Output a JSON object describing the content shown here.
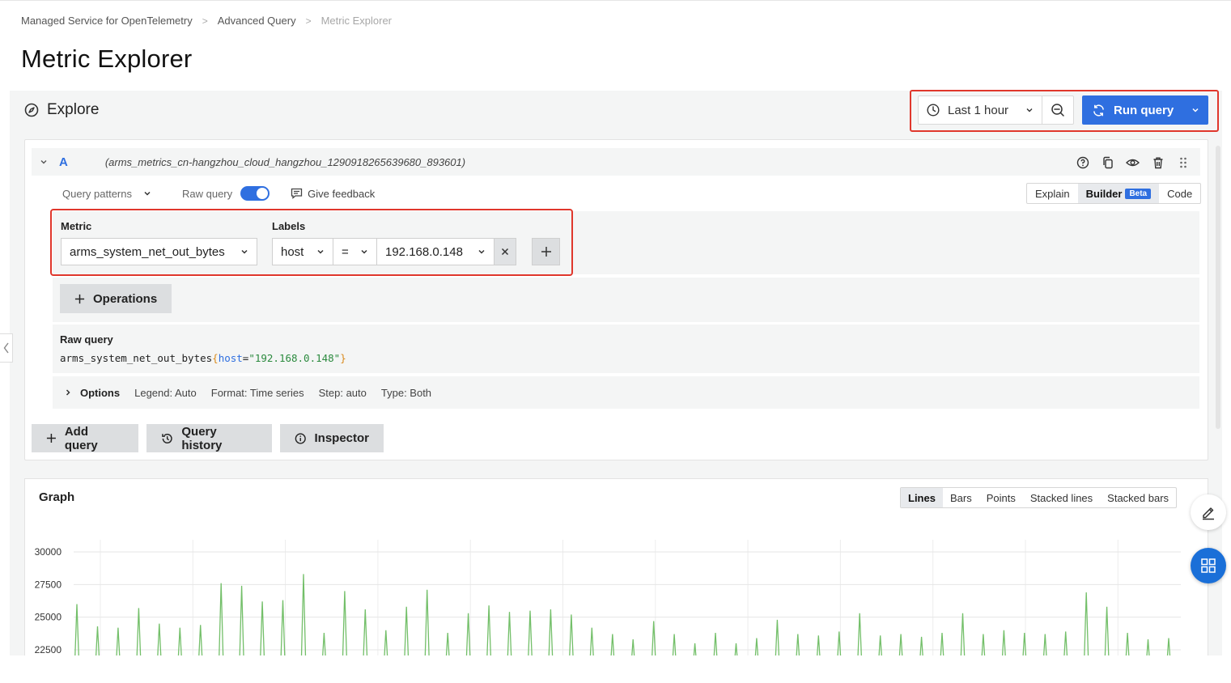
{
  "breadcrumb": {
    "items": [
      "Managed Service for OpenTelemetry",
      "Advanced Query",
      "Metric Explorer"
    ],
    "separator": ">"
  },
  "page_title": "Metric Explorer",
  "explore": {
    "title": "Explore",
    "time_range": "Last 1 hour",
    "run_query": "Run query"
  },
  "query": {
    "letter": "A",
    "datasource": "(arms_metrics_cn-hangzhou_cloud_hangzhou_1290918265639680_893601)",
    "query_patterns": "Query patterns",
    "raw_query_toggle": "Raw query",
    "raw_query_enabled": true,
    "give_feedback": "Give feedback",
    "modes": [
      "Explain",
      "Builder",
      "Code"
    ],
    "active_mode": "Builder",
    "beta_badge": "Beta",
    "metric_label": "Metric",
    "metric_value": "arms_system_net_out_bytes",
    "labels_label": "Labels",
    "label_key": "host",
    "label_op": "=",
    "label_value": "192.168.0.148",
    "operations_button": "Operations",
    "raw_query_title": "Raw query",
    "raw_query_metric": "arms_system_net_out_bytes",
    "raw_query_open": "{",
    "raw_query_key": "host",
    "raw_query_eq": "=",
    "raw_query_val": "\"192.168.0.148\"",
    "raw_query_close": "}",
    "options": {
      "title": "Options",
      "legend": "Legend: Auto",
      "format": "Format: Time series",
      "step": "Step: auto",
      "type": "Type: Both"
    }
  },
  "actions": {
    "add_query": "Add query",
    "query_history": "Query history",
    "inspector": "Inspector"
  },
  "graph": {
    "title": "Graph",
    "modes": [
      "Lines",
      "Bars",
      "Points",
      "Stacked lines",
      "Stacked bars"
    ],
    "active_mode": "Lines"
  },
  "colors": {
    "primary": "#2f6fe0",
    "highlight_border": "#e0372c",
    "series": "#73bf69"
  },
  "chart_data": {
    "type": "line",
    "y_ticks": [
      30000,
      27500,
      25000,
      22500
    ],
    "ylim": [
      22400,
      31000
    ],
    "grid": true,
    "series": [
      {
        "values": [
          26000,
          24300,
          24200,
          25700,
          24500,
          24200,
          24400,
          27600,
          27400,
          26200,
          26300,
          28300,
          23800,
          27000,
          25600,
          24000,
          25800,
          27100,
          23800,
          25300,
          25900,
          25400,
          25500,
          25600,
          25200,
          24200,
          23700,
          23300,
          24700,
          23700,
          23000,
          23800,
          23000,
          23400,
          24800,
          23700,
          23600,
          23900,
          25300,
          23600,
          23700,
          23500,
          23800,
          25300,
          23700,
          24000,
          23800,
          23700,
          23900,
          26900,
          25800,
          23800,
          23300,
          23400
        ]
      }
    ]
  }
}
